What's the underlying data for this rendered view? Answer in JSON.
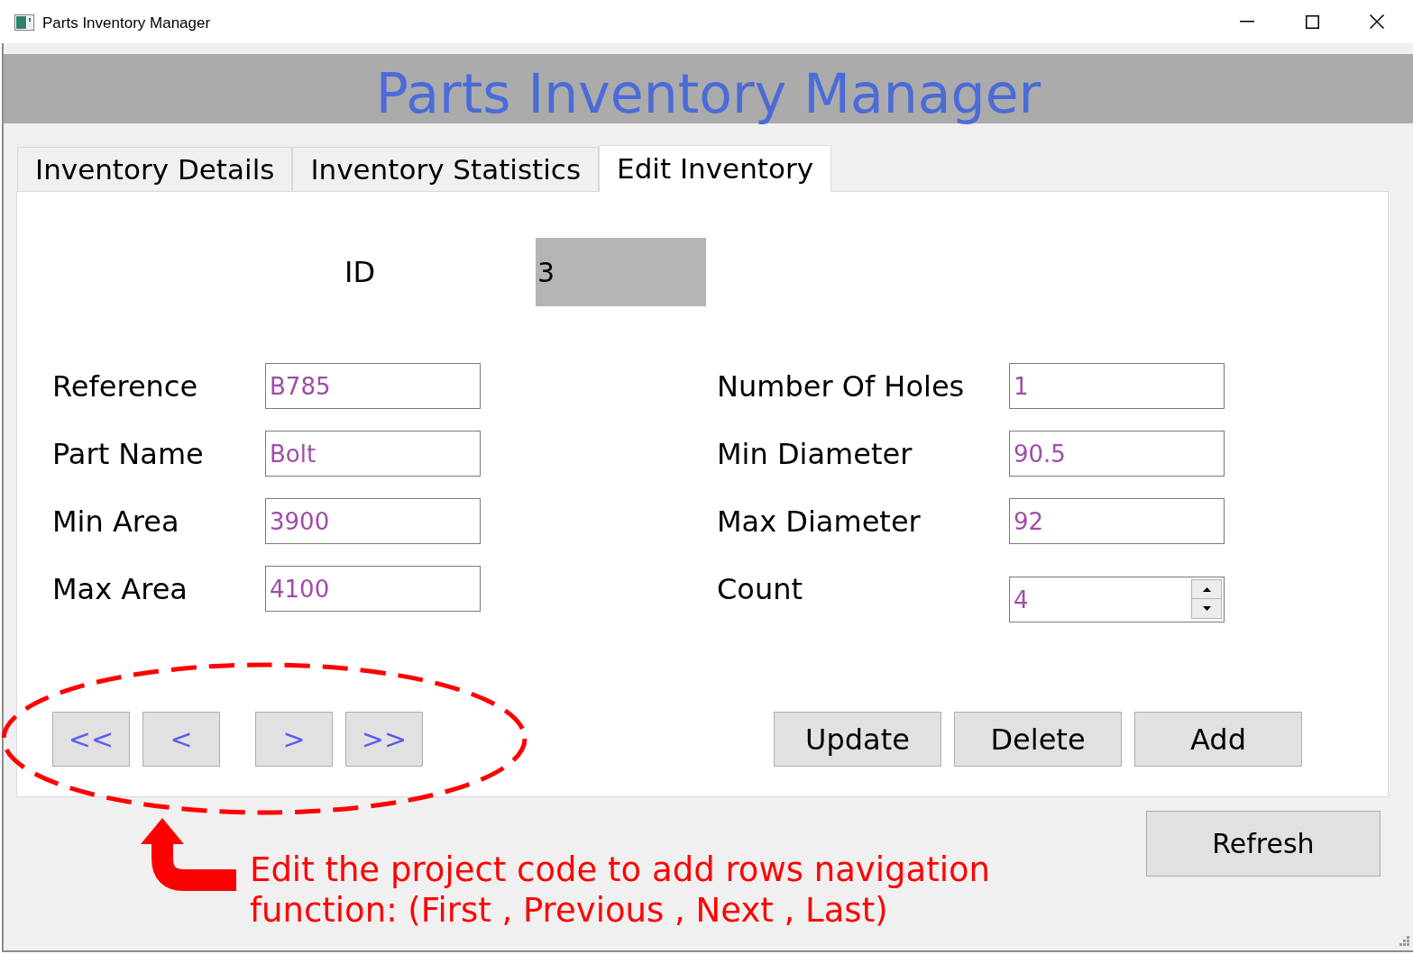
{
  "window": {
    "title": "Parts Inventory Manager"
  },
  "header": {
    "title": "Parts Inventory Manager"
  },
  "tabs": [
    {
      "label": "Inventory Details",
      "selected": false
    },
    {
      "label": "Inventory Statistics",
      "selected": false
    },
    {
      "label": "Edit Inventory",
      "selected": true
    }
  ],
  "id_field": {
    "label": "ID",
    "value": "3"
  },
  "left_fields": [
    {
      "label": "Reference",
      "value": "B785",
      "kind": "text"
    },
    {
      "label": "Part Name",
      "value": "Bolt",
      "kind": "text"
    },
    {
      "label": "Min Area",
      "value": "3900",
      "kind": "text"
    },
    {
      "label": "Max Area",
      "value": "4100",
      "kind": "text"
    }
  ],
  "right_fields": [
    {
      "label": "Number Of Holes",
      "value": "1",
      "kind": "text"
    },
    {
      "label": "Min Diameter",
      "value": "90.5",
      "kind": "text"
    },
    {
      "label": "Max Diameter",
      "value": "92",
      "kind": "text"
    },
    {
      "label": "Count",
      "value": "4",
      "kind": "spinbox"
    }
  ],
  "navigation_buttons": [
    "<<",
    "<",
    ">",
    ">>"
  ],
  "action_buttons": [
    "Update",
    "Delete",
    "Add"
  ],
  "refresh_button": "Refresh",
  "annotation": {
    "note_lines": [
      "Edit the project code to add rows navigation",
      "function: (First , Previous , Next , Last)"
    ]
  }
}
